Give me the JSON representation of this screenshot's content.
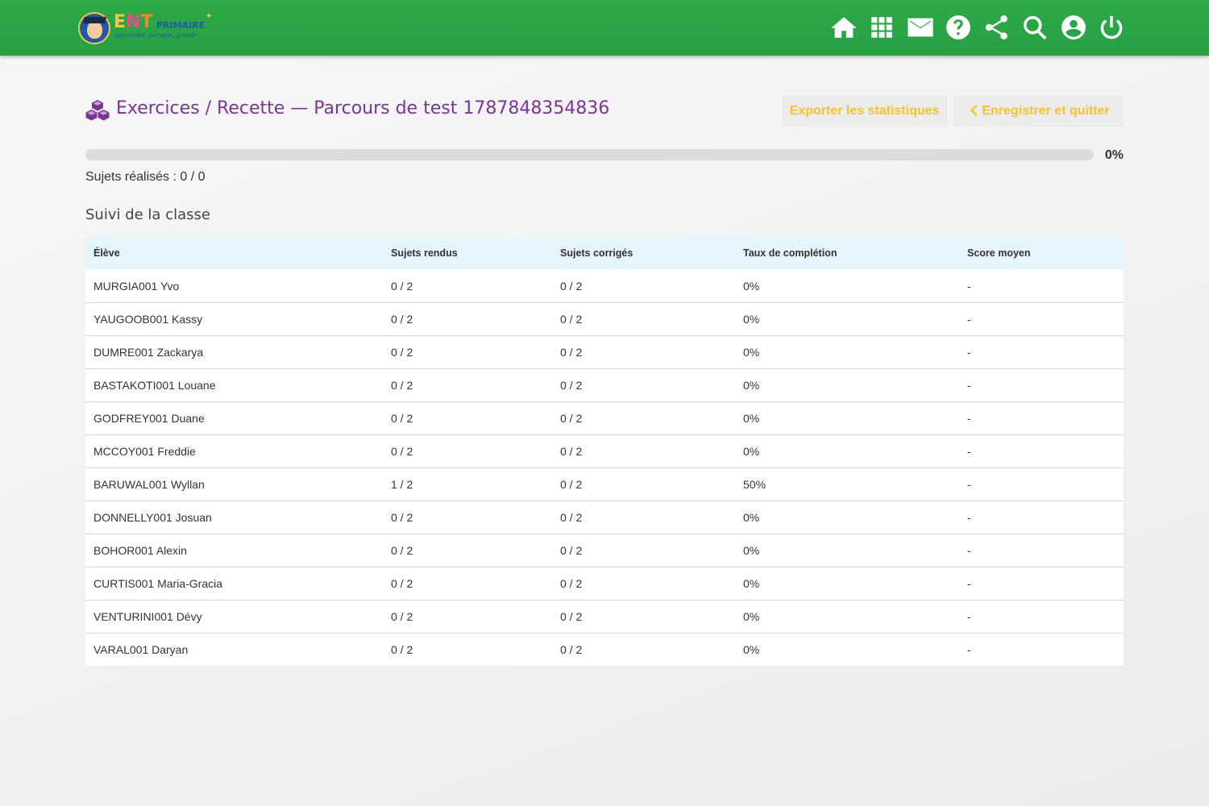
{
  "header": {
    "logo": {
      "ent": "ENT",
      "primaire": "PRIMAIRE",
      "tagline": "Apprendre, partager, grandir"
    },
    "icons": [
      "home-icon",
      "apps-icon",
      "mail-icon",
      "help-icon",
      "share-icon",
      "search-icon",
      "user-icon",
      "power-icon"
    ]
  },
  "page": {
    "title": "Exercices / Recette — Parcours de test 1787848354836",
    "export_label": "Exporter les statistiques",
    "save_label": "Enregistrer et quitter",
    "progress_percent": "0%",
    "progress_value": 0,
    "subjects_done": "Sujets réalisés : 0 / 0",
    "section_title": "Suivi de la classe"
  },
  "colors": {
    "header": "#2eaa4a",
    "title": "#7a3593",
    "button_text": "#f7c22e",
    "table_header": "#e6f4fc"
  },
  "table": {
    "headers": [
      "Élève",
      "Sujets rendus",
      "Sujets corrigés",
      "Taux de complétion",
      "Score moyen"
    ],
    "rows": [
      [
        "MURGIA001 Yvo",
        "0 / 2",
        "0 / 2",
        "0%",
        "-"
      ],
      [
        "YAUGOOB001 Kassy",
        "0 / 2",
        "0 / 2",
        "0%",
        "-"
      ],
      [
        "DUMRE001 Zackarya",
        "0 / 2",
        "0 / 2",
        "0%",
        "-"
      ],
      [
        "BASTAKOTI001 Louane",
        "0 / 2",
        "0 / 2",
        "0%",
        "-"
      ],
      [
        "GODFREY001 Duane",
        "0 / 2",
        "0 / 2",
        "0%",
        "-"
      ],
      [
        "MCCOY001 Freddie",
        "0 / 2",
        "0 / 2",
        "0%",
        "-"
      ],
      [
        "BARUWAL001 Wyllan",
        "1 / 2",
        "0 / 2",
        "50%",
        "-"
      ],
      [
        "DONNELLY001 Josuan",
        "0 / 2",
        "0 / 2",
        "0%",
        "-"
      ],
      [
        "BOHOR001 Alexin",
        "0 / 2",
        "0 / 2",
        "0%",
        "-"
      ],
      [
        "CURTIS001 Maria-Gracia",
        "0 / 2",
        "0 / 2",
        "0%",
        "-"
      ],
      [
        "VENTURINI001 Dévy",
        "0 / 2",
        "0 / 2",
        "0%",
        "-"
      ],
      [
        "VARAL001 Daryan",
        "0 / 2",
        "0 / 2",
        "0%",
        "-"
      ]
    ]
  }
}
